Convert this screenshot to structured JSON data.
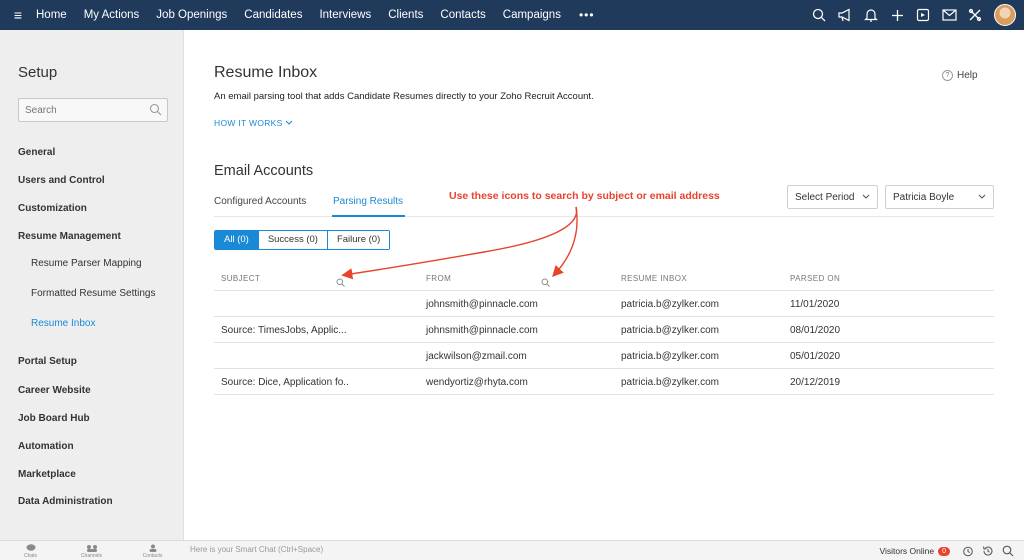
{
  "nav": {
    "items": [
      "Home",
      "My Actions",
      "Job Openings",
      "Candidates",
      "Interviews",
      "Clients",
      "Contacts",
      "Campaigns"
    ],
    "more": "•••",
    "right_icons": [
      "search-icon",
      "megaphone-icon",
      "bell-icon",
      "plus-icon",
      "calendar-icon",
      "mail-icon",
      "tools-icon"
    ]
  },
  "sidebar": {
    "title": "Setup",
    "search_placeholder": "Search",
    "items": [
      {
        "label": "General"
      },
      {
        "label": "Users and Control"
      },
      {
        "label": "Customization"
      },
      {
        "label": "Resume Management"
      },
      {
        "label": "Resume Parser Mapping",
        "sub": true
      },
      {
        "label": "Formatted Resume Settings",
        "sub": true
      },
      {
        "label": "Resume Inbox",
        "sub": true,
        "active": true
      },
      {
        "label": "Portal Setup"
      },
      {
        "label": "Career Website"
      },
      {
        "label": "Job Board Hub"
      },
      {
        "label": "Automation"
      },
      {
        "label": "Marketplace"
      },
      {
        "label": "Data Administration"
      }
    ]
  },
  "main": {
    "title": "Resume Inbox",
    "description": "An email parsing tool that adds Candidate Resumes directly to your Zoho Recruit Account.",
    "how_it_works": "HOW IT WORKS",
    "help": "Help",
    "section_title": "Email Accounts",
    "tabs": [
      {
        "label": "Configured Accounts",
        "active": false
      },
      {
        "label": "Parsing Results",
        "active": true
      }
    ],
    "annotation": "Use these icons to search by subject or email address",
    "period_select": "Select Period",
    "user_select": "Patricia Boyle",
    "filters": [
      "All (0)",
      "Success (0)",
      "Failure (0)"
    ],
    "table": {
      "headers": [
        "SUBJECT",
        "FROM",
        "RESUME INBOX",
        "PARSED ON"
      ],
      "rows": [
        {
          "subject": "",
          "from": "johnsmith@pinnacle.com",
          "inbox": "patricia.b@zylker.com",
          "parsed": "11/01/2020"
        },
        {
          "subject": "Source: TimesJobs, Applic...",
          "from": "johnsmith@pinnacle.com",
          "inbox": "patricia.b@zylker.com",
          "parsed": "08/01/2020"
        },
        {
          "subject": "",
          "from": "jackwilson@zmail.com",
          "inbox": "patricia.b@zylker.com",
          "parsed": "05/01/2020"
        },
        {
          "subject": "Source: Dice, Application fo..",
          "from": "wendyortiz@rhyta.com",
          "inbox": "patricia.b@zylker.com",
          "parsed": "20/12/2019"
        }
      ]
    }
  },
  "bottom": {
    "tools": [
      "Chats",
      "Channels",
      "Contacts"
    ],
    "smart_chat_placeholder": "Here is your Smart Chat (Ctrl+Space)",
    "visitors_online": "Visitors Online",
    "visitors_count": "0"
  },
  "colors": {
    "nav_bg": "#1f3a5a",
    "accent": "#1a8ad6",
    "annotation": "#e8432d"
  }
}
